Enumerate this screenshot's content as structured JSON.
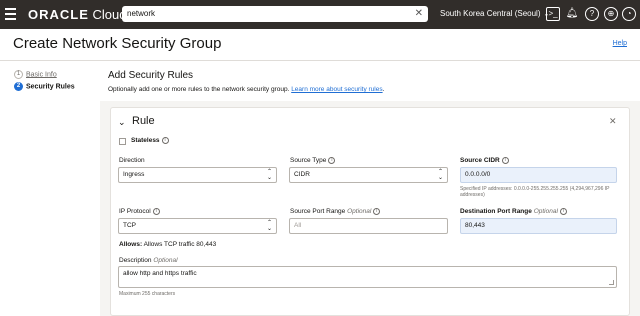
{
  "topbar": {
    "brand_main": "ORACLE",
    "brand_sub": " Cloud",
    "search_value": "network",
    "region": "South Korea Central (Seoul)"
  },
  "page": {
    "title": "Create Network Security Group",
    "help": "Help"
  },
  "steps": [
    {
      "num": "1",
      "label": "Basic Info"
    },
    {
      "num": "2",
      "label": "Security Rules"
    }
  ],
  "section": {
    "title": "Add Security Rules",
    "desc": "Optionally add one or more rules to the network security group. ",
    "learn_more": "Learn more about security rules",
    "desc_end": "."
  },
  "rule": {
    "title": "Rule",
    "stateless_label": "Stateless",
    "direction_label": "Direction",
    "direction_value": "Ingress",
    "source_type_label": "Source Type",
    "source_type_value": "CIDR",
    "source_cidr_label": "Source CIDR",
    "source_cidr_value": "0.0.0.0/0",
    "source_cidr_hint": "Specified IP addresses: 0.0.0.0-255.255.255.255 (4,294,967,296 IP addresses)",
    "ip_protocol_label": "IP Protocol",
    "ip_protocol_value": "TCP",
    "source_port_label": "Source Port Range",
    "optional": "Optional",
    "source_port_placeholder": "All",
    "dest_port_label": "Destination Port Range",
    "dest_port_value": "80,443",
    "allows_label": "Allows:",
    "allows_text": " Allows TCP traffic 80,443",
    "description_label": "Description",
    "description_value": "allow http and https traffic",
    "description_hint": "Maximum 255 characters"
  },
  "colors": {
    "topbar": "#312d2a",
    "accent": "#1f6ed4",
    "filled_field": "#eaf1fb"
  }
}
